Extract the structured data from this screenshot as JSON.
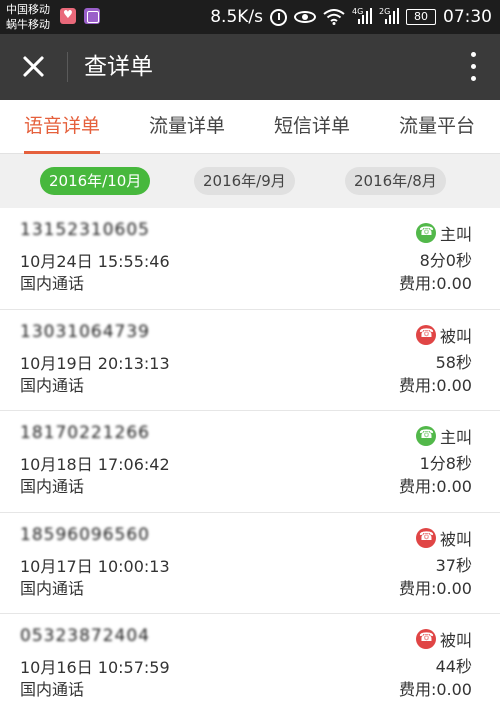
{
  "status_bar": {
    "carrier_line1": "中国移动",
    "carrier_line2": "蜗牛移动",
    "speed": "8.5K/s",
    "net_tag_1": "4G",
    "net_tag_2": "2G",
    "battery": "80",
    "time": "07:30"
  },
  "app_bar": {
    "title": "查详单"
  },
  "tabs": [
    {
      "label": "语音详单",
      "active": true
    },
    {
      "label": "流量详单",
      "active": false
    },
    {
      "label": "短信详单",
      "active": false
    },
    {
      "label": "流量平台",
      "active": false
    }
  ],
  "months": [
    {
      "label": "2016年/10月",
      "active": true
    },
    {
      "label": "2016年/9月",
      "active": false
    },
    {
      "label": "2016年/8月",
      "active": false
    }
  ],
  "records": [
    {
      "number": "13152310605",
      "datetime": "10月24日 15:55:46",
      "type": "国内通话",
      "direction": "主叫",
      "call": "out",
      "duration": "8分0秒",
      "fee": "费用:0.00"
    },
    {
      "number": "13031064739",
      "datetime": "10月19日 20:13:13",
      "type": "国内通话",
      "direction": "被叫",
      "call": "in",
      "duration": "58秒",
      "fee": "费用:0.00"
    },
    {
      "number": "18170221266",
      "datetime": "10月18日 17:06:42",
      "type": "国内通话",
      "direction": "主叫",
      "call": "out",
      "duration": "1分8秒",
      "fee": "费用:0.00"
    },
    {
      "number": "18596096560",
      "datetime": "10月17日 10:00:13",
      "type": "国内通话",
      "direction": "被叫",
      "call": "in",
      "duration": "37秒",
      "fee": "费用:0.00"
    },
    {
      "number": "05323872404",
      "datetime": "10月16日 10:57:59",
      "type": "国内通话",
      "direction": "被叫",
      "call": "in",
      "duration": "44秒",
      "fee": "费用:0.00"
    }
  ],
  "colors": {
    "accent": "#e5603c",
    "month_active": "#47b83d",
    "call_out": "#52b84a",
    "call_in": "#e04545",
    "app_bar": "#3a3a3a"
  }
}
